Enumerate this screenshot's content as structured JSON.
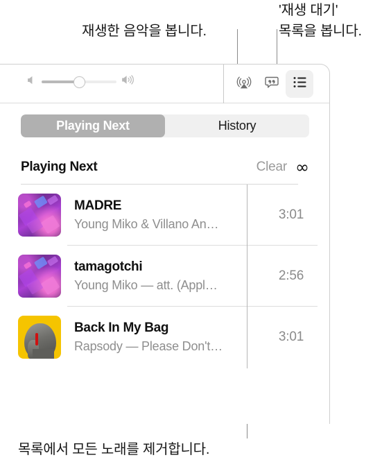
{
  "callouts": {
    "history": "재생한 음악을 봅니다.",
    "queue": "'재생 대기'\n목록을 봅니다.",
    "queue_line1": "'재생 대기'",
    "queue_line2": "목록을 봅니다.",
    "clear": "목록에서 모든 노래를 제거합니다."
  },
  "toolbar": {
    "volume": {
      "min_icon": "speaker-low-icon",
      "max_icon": "speaker-high-icon",
      "value": 50
    },
    "buttons": [
      {
        "name": "airplay-icon",
        "label": "AirPlay",
        "active": false
      },
      {
        "name": "lyrics-icon",
        "label": "Lyrics",
        "active": false
      },
      {
        "name": "queue-list-icon",
        "label": "Playing Next",
        "active": true
      }
    ]
  },
  "tabs": [
    {
      "label": "Playing Next",
      "active": true
    },
    {
      "label": "History",
      "active": false
    }
  ],
  "section": {
    "title": "Playing Next",
    "clear_label": "Clear",
    "infinity_glyph": "∞"
  },
  "tracks": [
    {
      "title": "MADRE",
      "subtitle": "Young Miko & Villano An…",
      "duration": "3:01",
      "art": "purple",
      "art_name": "album-art-madre"
    },
    {
      "title": "tamagotchi",
      "subtitle": "Young Miko — att. (Appl…",
      "duration": "2:56",
      "art": "purple",
      "art_name": "album-art-tamagotchi"
    },
    {
      "title": "Back In My Bag",
      "subtitle": "Rapsody — Please Don't…",
      "duration": "3:01",
      "art": "yellow",
      "art_name": "album-art-back-in-my-bag"
    }
  ],
  "colors": {
    "active_tab_bg": "#b0b0b0",
    "segmented_bg": "#f0f0f0",
    "active_icon_bg": "#f0f0f0",
    "text_primary": "#101010",
    "text_secondary": "#8e8e8e",
    "leader_line": "#8a8a8a",
    "panel_border": "#cfcfcf",
    "art_yellow": "#f5c400"
  }
}
